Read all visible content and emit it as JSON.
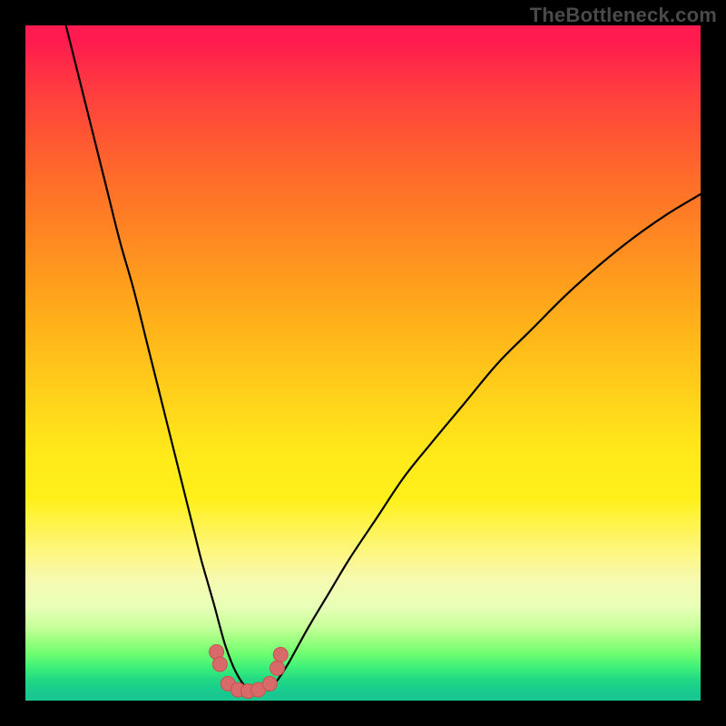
{
  "watermark": {
    "text": "TheBottleneck.com"
  },
  "colors": {
    "frame": "#000000",
    "curve": "#000000",
    "marker_fill": "#d86a6a",
    "marker_stroke": "#c85050",
    "gradient_stops": [
      "#ff1a50",
      "#ff3e3e",
      "#ff6a2a",
      "#ff8a22",
      "#ffaa1a",
      "#ffd21a",
      "#ffe81a",
      "#fdf780",
      "#e8ffb8",
      "#70ff70",
      "#20d884",
      "#18c890"
    ]
  },
  "chart_data": {
    "type": "line",
    "title": "",
    "xlabel": "",
    "ylabel": "",
    "xlim": [
      0,
      100
    ],
    "ylim": [
      0,
      100
    ],
    "grid": false,
    "legend": false,
    "series": [
      {
        "name": "left_branch",
        "x": [
          6,
          8,
          10,
          12,
          14,
          16,
          18,
          20,
          22,
          24,
          25,
          26,
          27,
          28,
          28.8,
          29.5,
          30.2,
          30.8,
          31.4,
          32,
          33
        ],
        "values": [
          100,
          92,
          84,
          76,
          68,
          61,
          53,
          45,
          37,
          29,
          25,
          21,
          17.5,
          14,
          11,
          8.5,
          6.5,
          5,
          3.8,
          2.8,
          1.5
        ]
      },
      {
        "name": "right_branch",
        "x": [
          36,
          37,
          38,
          39,
          40,
          42,
          45,
          48,
          52,
          56,
          60,
          65,
          70,
          75,
          80,
          85,
          90,
          95,
          100
        ],
        "values": [
          1.5,
          2.6,
          4,
          5.6,
          7.4,
          11,
          16,
          21,
          27,
          33,
          38,
          44,
          50,
          55,
          60,
          64.5,
          68.5,
          72,
          75
        ]
      }
    ],
    "markers": {
      "name": "bottom_cluster",
      "x": [
        28.3,
        28.8,
        30.0,
        31.5,
        33.0,
        34.5,
        36.2,
        37.3,
        37.8
      ],
      "values": [
        7.2,
        5.4,
        2.5,
        1.6,
        1.4,
        1.6,
        2.5,
        4.8,
        6.8
      ]
    }
  }
}
